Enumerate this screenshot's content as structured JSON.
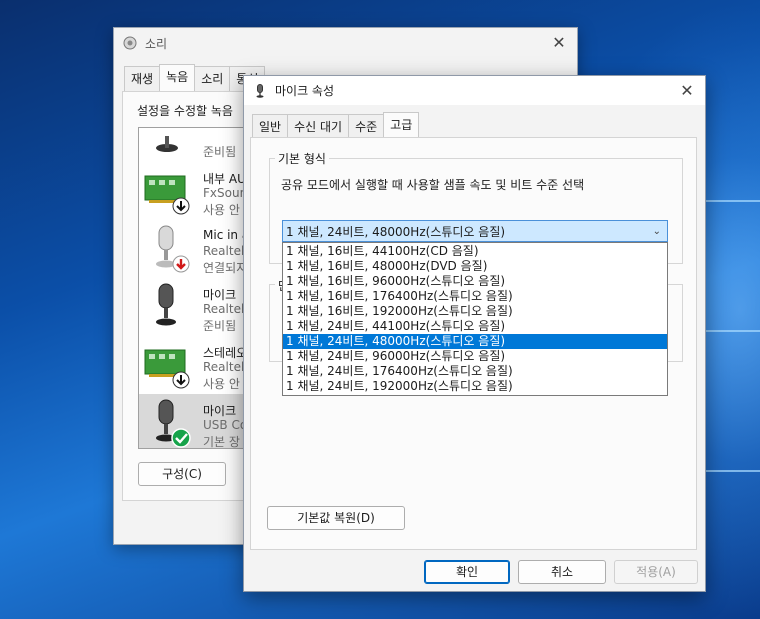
{
  "back_window": {
    "title": "소리",
    "tabs": [
      "재생",
      "녹음",
      "소리",
      "통신"
    ],
    "active_tab": 1,
    "instruction": "설정을 수정할 녹음",
    "devices": [
      {
        "name": "",
        "sub": "",
        "status": "준비됨",
        "icon": "microphone-icon",
        "badge": ""
      },
      {
        "name": "내부 AU",
        "sub": "FxSoun",
        "status": "사용 안",
        "icon": "sound-card-icon",
        "badge": "disabled-arrow-icon"
      },
      {
        "name": "Mic in a",
        "sub": "Realtek",
        "status": "연결되지",
        "icon": "microphone-icon",
        "badge": "unplugged-icon"
      },
      {
        "name": "마이크",
        "sub": "Realtek",
        "status": "준비됨",
        "icon": "microphone-icon",
        "badge": ""
      },
      {
        "name": "스테레오",
        "sub": "Realtek",
        "status": "사용 안",
        "icon": "sound-card-icon",
        "badge": "disabled-arrow-icon"
      },
      {
        "name": "마이크",
        "sub": "USB Co",
        "status": "기본 장",
        "icon": "microphone-icon",
        "badge": "default-check-icon"
      }
    ],
    "configure_button": "구성(C)"
  },
  "front_window": {
    "title": "마이크 속성",
    "tabs": [
      "일반",
      "수신 대기",
      "수준",
      "고급"
    ],
    "active_tab": 3,
    "group_label": "기본 형식",
    "group_description": "공유 모드에서 실행할 때 사용할 샘플 속도 및 비트 수준 선택",
    "group2_label": "단",
    "selected_format": "1 채널, 24비트, 48000Hz(스튜디오 음질)",
    "format_options": [
      "1 채널, 16비트, 44100Hz(CD 음질)",
      "1 채널, 16비트, 48000Hz(DVD 음질)",
      "1 채널, 16비트, 96000Hz(스튜디오 음질)",
      "1 채널, 16비트, 176400Hz(스튜디오 음질)",
      "1 채널, 16비트, 192000Hz(스튜디오 음질)",
      "1 채널, 24비트, 44100Hz(스튜디오 음질)",
      "1 채널, 24비트, 48000Hz(스튜디오 음질)",
      "1 채널, 24비트, 96000Hz(스튜디오 음질)",
      "1 채널, 24비트, 176400Hz(스튜디오 음질)",
      "1 채널, 24비트, 192000Hz(스튜디오 음질)"
    ],
    "highlighted_option": 6,
    "restore_defaults_button": "기본값 복원(D)",
    "ok_button": "확인",
    "cancel_button": "취소",
    "apply_button": "적용(A)"
  },
  "colors": {
    "accent": "#0078d7",
    "combo_bg": "#cde8ff",
    "unplugged": "#d01919",
    "default_check": "#16a34a"
  }
}
